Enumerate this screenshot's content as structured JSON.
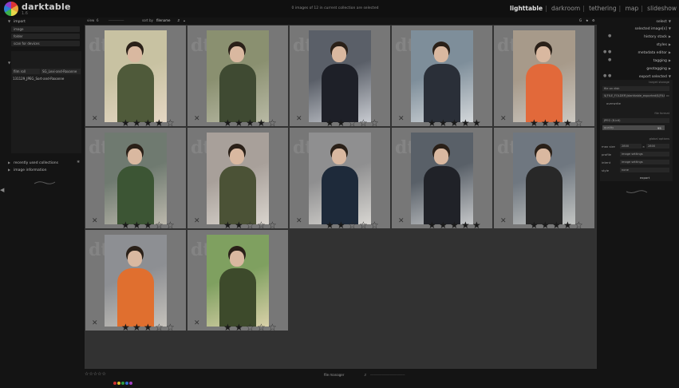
{
  "header": {
    "app_name": "darktable",
    "app_sub": "1.6",
    "selection_info": "0 images of 12 in current collection are selected",
    "views": [
      "lighttable",
      "darkroom",
      "tethering",
      "map",
      "slideshow"
    ],
    "active_view": "lighttable"
  },
  "left": {
    "import": {
      "title": "import",
      "buttons": [
        "image",
        "folder",
        "scan for devices"
      ],
      "devices_note": "no supported devices found"
    },
    "collect": {
      "title": "collect images",
      "property": "film roll",
      "value": "SG_Lexi-and-Roxanne",
      "entry": "131129_JPEG_Sort-and-Roxanne"
    },
    "recent": {
      "title": "recently used collections"
    },
    "info": {
      "title": "image information"
    }
  },
  "topbar": {
    "view_label": "view",
    "view_value": "6",
    "sort_label": "sort by",
    "sort_value": "filename"
  },
  "thumbnails": [
    {
      "rating": 4,
      "colors": [
        "#c8c2a2",
        "#4f5a3a",
        "#e5d7c4"
      ]
    },
    {
      "rating": 4,
      "colors": [
        "#8a9070",
        "#3f4a32",
        "#b8b9a4"
      ]
    },
    {
      "rating": 2,
      "colors": [
        "#5a5f68",
        "#1e2028",
        "#c7cad0"
      ]
    },
    {
      "rating": 5,
      "colors": [
        "#7e8e9a",
        "#2a2f38",
        "#d3d7da"
      ]
    },
    {
      "rating": 4,
      "colors": [
        "#a79a8a",
        "#e2693a",
        "#cbc7c0"
      ]
    },
    {
      "rating": 3,
      "colors": [
        "#6f7a70",
        "#3c5534",
        "#bbb8ac"
      ]
    },
    {
      "rating": 2,
      "colors": [
        "#a8a09a",
        "#4b5236",
        "#d9d4cd"
      ]
    },
    {
      "rating": 2,
      "colors": [
        "#8f8f90",
        "#1e2a3a",
        "#d8d6d2"
      ]
    },
    {
      "rating": 5,
      "colors": [
        "#596068",
        "#202228",
        "#c4c6c8"
      ]
    },
    {
      "rating": 4,
      "colors": [
        "#6f7780",
        "#282828",
        "#c2c4c2"
      ]
    },
    {
      "rating": 3,
      "colors": [
        "#8d8f93",
        "#e06f2f",
        "#c5c2bc"
      ]
    },
    {
      "rating": 2,
      "colors": [
        "#7fa060",
        "#3d4a2b",
        "#d8d0a8"
      ]
    }
  ],
  "right": {
    "headers": [
      "select",
      "selected image[s]",
      "history stack",
      "styles",
      "metadata editor",
      "tagging",
      "geotagging",
      "export selected"
    ],
    "export": {
      "target_storage": "target storage",
      "storage": "file on disk",
      "path": "$(FILE_FOLDER)/darktable_exported/$(FILE_NAME)",
      "on_conflict": "overwrite",
      "file_format_label": "file format",
      "format": "JPEG (8-bit)",
      "quality_label": "quality",
      "quality": "95",
      "global_options": "global options",
      "max_size_label": "max size",
      "max_w": "2800",
      "max_h": "2800",
      "profile_label": "profile",
      "profile_value": "image settings",
      "intent_label": "intent",
      "intent_value": "image settings",
      "style_label": "style",
      "style_value": "none",
      "export_button": "export"
    }
  },
  "bottom": {
    "film_manager": "file manager",
    "color_labels": [
      "#d03030",
      "#e0c030",
      "#30a040",
      "#3070d0",
      "#a040c0"
    ]
  }
}
